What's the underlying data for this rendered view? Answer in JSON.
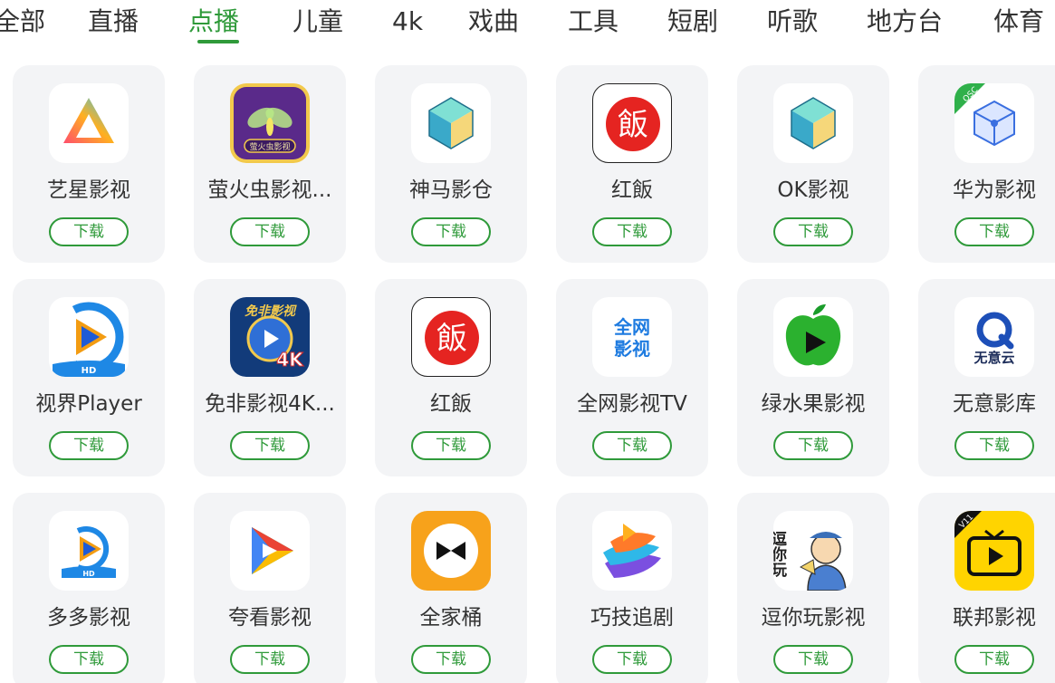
{
  "tabs": {
    "items": [
      "全部",
      "直播",
      "点播",
      "儿童",
      "4k",
      "戏曲",
      "工具",
      "短剧",
      "听歌",
      "地方台",
      "体育"
    ],
    "active": "点播"
  },
  "apps": {
    "download_label": "下载",
    "items": [
      {
        "name": "艺星影视",
        "icon": "yixing-prism-icon"
      },
      {
        "name": "萤火虫影视...",
        "icon": "firefly-icon",
        "icon_text": "萤火虫影视"
      },
      {
        "name": "神马影仓",
        "icon": "shenma-cube-icon"
      },
      {
        "name": "红飯",
        "icon": "hongfan-icon",
        "icon_text": "飯"
      },
      {
        "name": "OK影视",
        "icon": "ok-cube-icon"
      },
      {
        "name": "华为影视",
        "icon": "huawei-cube-icon",
        "icon_text": "OSC"
      },
      {
        "name": "视界Player",
        "icon": "shijie-play-icon",
        "icon_text": "HD"
      },
      {
        "name": "免非影视4K...",
        "icon": "mianfei-4k-icon",
        "icon_text": "免非影视",
        "icon_text2": "4K"
      },
      {
        "name": "红飯",
        "icon": "hongfan-icon",
        "icon_text": "飯"
      },
      {
        "name": "全网影视TV",
        "icon": "quanwang-text-icon",
        "icon_text": "全网",
        "icon_text2": "影视"
      },
      {
        "name": "绿水果影视",
        "icon": "green-apple-icon"
      },
      {
        "name": "无意影库",
        "icon": "wuyiyun-icon",
        "icon_text": "无意云"
      },
      {
        "name": "多多影视",
        "icon": "duoduo-play-icon",
        "icon_text": "HD"
      },
      {
        "name": "夸看影视",
        "icon": "kuakan-play-icon"
      },
      {
        "name": "全家桶",
        "icon": "quanjiatong-bowtie-icon"
      },
      {
        "name": "巧技追剧",
        "icon": "qiaoji-wave-icon"
      },
      {
        "name": "逗你玩影视",
        "icon": "douniwan-cartoon-icon",
        "icon_text": "逗你玩"
      },
      {
        "name": "联邦影视",
        "icon": "lianbang-tv-icon",
        "icon_text": "V11"
      }
    ]
  },
  "colors": {
    "accent": "#2f9a3a",
    "text": "#333333",
    "card_bg": "#f3f4f6"
  }
}
